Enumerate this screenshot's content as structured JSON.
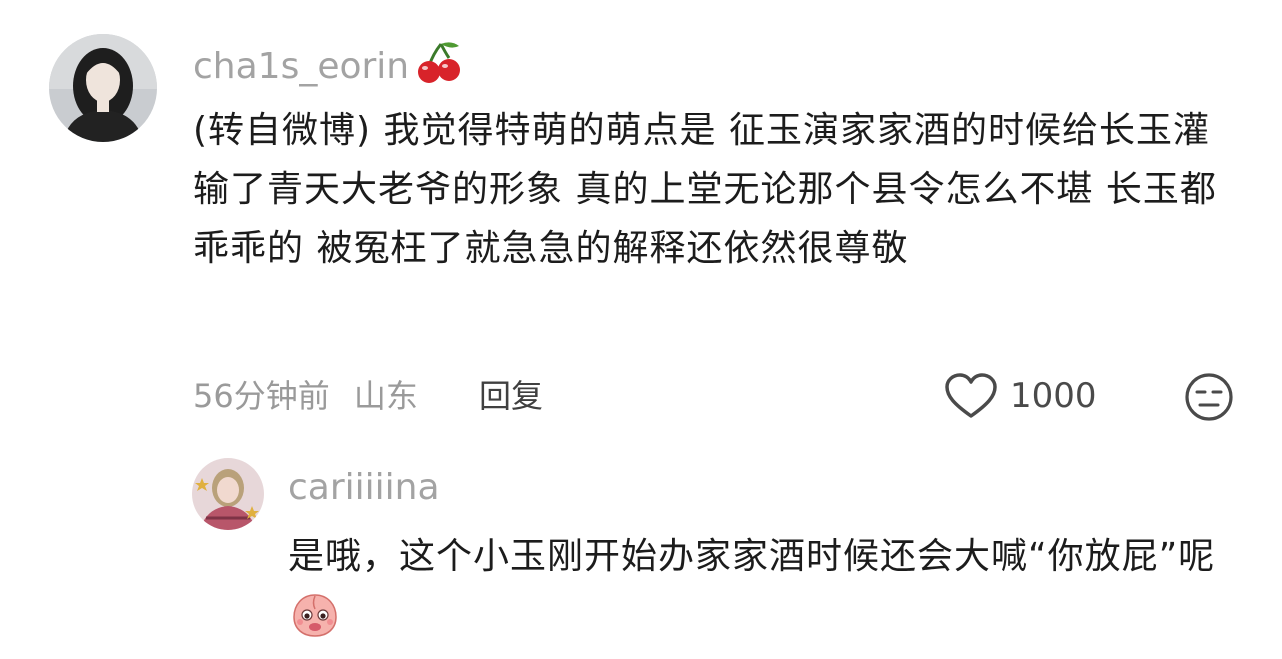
{
  "comment": {
    "username": "cha1s_eorin",
    "badge_icon": "cherry-icon",
    "text": "(转自微博) 我觉得特萌的萌点是 征玉演家家酒的时候给长玉灌输了青天大老爷的形象 真的上堂无论那个县令怎么不堪 长玉都乖乖的 被冤枉了就急急的解释还依然很尊敬",
    "time": "56分钟前",
    "location": "山东",
    "reply_label": "回复",
    "like_count": "1000",
    "like_icon": "heart-outline-icon",
    "react_icon": "neutral-face-icon"
  },
  "reply": {
    "username": "cariiiiina",
    "text": "是哦，这个小玉刚开始办家家酒时候还会大喊“你放屁”呢",
    "emoji_icon": "pleading-peach-icon"
  },
  "colors": {
    "username": "#a3a3a3",
    "body_text": "#1c1c1c",
    "meta": "#9a9a9a",
    "cherry": "#d8232a"
  }
}
